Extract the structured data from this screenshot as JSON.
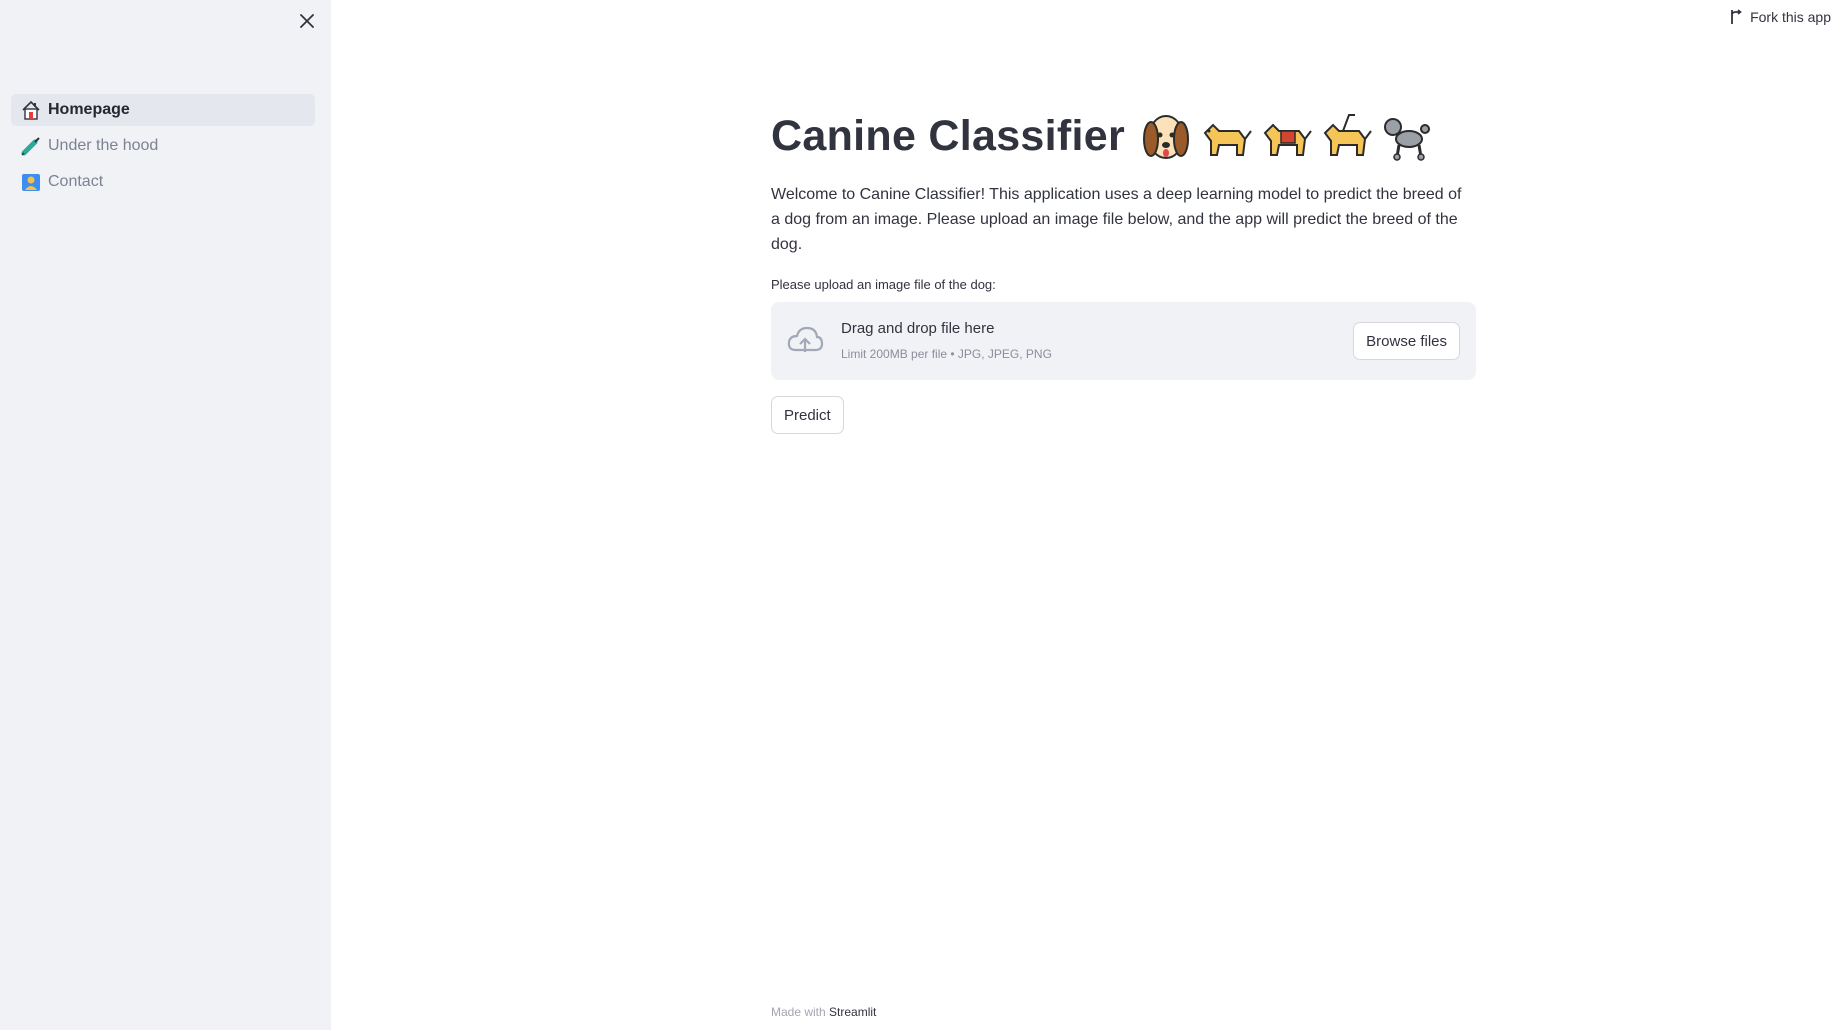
{
  "sidebar": {
    "items": [
      {
        "label": "Homepage",
        "icon": "house-icon",
        "active": true
      },
      {
        "label": "Under the hood",
        "icon": "syringe-icon",
        "active": false
      },
      {
        "label": "Contact",
        "icon": "contact-icon",
        "active": false
      }
    ]
  },
  "header": {
    "fork_label": "Fork this app"
  },
  "main": {
    "title": "Canine Classifier",
    "title_emojis": [
      "dog-face-icon",
      "dog-icon",
      "service-dog-icon",
      "guide-dog-icon",
      "poodle-icon"
    ],
    "welcome": "Welcome to Canine Classifier! This application uses a deep learning model to predict the breed of a dog from an image. Please upload an image file below, and the app will predict the breed of the dog.",
    "upload": {
      "label": "Please upload an image file of the dog:",
      "drop_title": "Drag and drop file here",
      "drop_subtitle": "Limit 200MB per file • JPG, JPEG, PNG",
      "browse_label": "Browse files"
    },
    "predict_label": "Predict"
  },
  "footer": {
    "prefix": "Made with",
    "brand": "Streamlit"
  },
  "colors": {
    "sidebar_bg": "#f0f2f6",
    "text": "#31333f",
    "muted": "#7d8293"
  }
}
